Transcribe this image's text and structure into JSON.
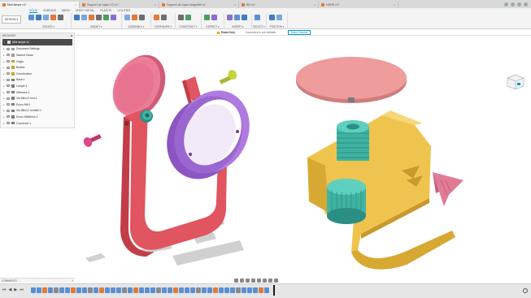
{
  "tabs": [
    {
      "label": "Mini lampe v1*",
      "active": true
    },
    {
      "label": "Support de tuyau V2 v1*",
      "active": false
    },
    {
      "label": "Support de tuyau Magnétik v1",
      "active": false
    },
    {
      "label": "BB v1*",
      "active": false
    },
    {
      "label": "HDRE v1*",
      "active": false
    }
  ],
  "ribbon": {
    "workspace": "DESIGN ▾",
    "workspace_tabs": [
      "SOLID",
      "SURFACE",
      "MESH",
      "SHEET METAL",
      "PLASTIC",
      "UTILITIES"
    ],
    "active_workspace_tab": "SOLID",
    "groups": [
      {
        "label": "CREATE ▾",
        "icons": [
          "sketch-icon",
          "extrude-icon",
          "revolve-icon",
          "hole-icon",
          "box-icon"
        ]
      },
      {
        "label": "MODIFY ▾",
        "icons": [
          "press-pull-icon",
          "fillet-icon",
          "chamfer-icon",
          "shell-icon",
          "combine-icon",
          "move-icon"
        ]
      },
      {
        "label": "ASSEMBLE ▾",
        "icons": [
          "new-component-icon",
          "joint-icon",
          "as-built-joint-icon"
        ]
      },
      {
        "label": "CONFIGURE ▾",
        "icons": [
          "configure-icon",
          "table-icon"
        ]
      },
      {
        "label": "CONSTRUCT ▾",
        "icons": [
          "offset-plane-icon",
          "axis-icon"
        ]
      },
      {
        "label": "INSPECT ▾",
        "icons": [
          "measure-icon",
          "interference-icon"
        ]
      },
      {
        "label": "INSERT ▾",
        "icons": [
          "insert-mesh-icon",
          "decal-icon",
          "canvas-icon"
        ]
      },
      {
        "label": "SELECT ▾",
        "icons": [
          "select-icon"
        ]
      },
      {
        "label": "POSITION ▾",
        "icons": [
          "capture-position-icon",
          "revert-icon"
        ]
      }
    ]
  },
  "status": {
    "read_only": "Read-Only",
    "message": "Document is not editable",
    "button": "Make Editable"
  },
  "browser": {
    "title": "BROWSER",
    "root": "Mini lampe v1",
    "items": [
      {
        "label": "Document Settings",
        "color": "#9e9e9e"
      },
      {
        "label": "Named Views",
        "color": "#9e9e9e"
      },
      {
        "label": "Origin",
        "color": "#c9a227"
      },
      {
        "label": "Bodies",
        "color": "#c9a227"
      },
      {
        "label": "Construction",
        "color": "#c9a227"
      },
      {
        "label": "Base:1",
        "color": "#7a7a7a"
      },
      {
        "label": "Lampe:1",
        "color": "#7a7a7a"
      },
      {
        "label": "Diffuseur:1",
        "color": "#7a7a7a"
      },
      {
        "label": "Vis M6x12 rom:1",
        "color": "#7a7a7a"
      },
      {
        "label": "Ecrou M6:1",
        "color": "#7a7a7a"
      },
      {
        "label": "Vis M6x12 rondelé:1",
        "color": "#7a7a7a"
      },
      {
        "label": "Ecrou M6Mince:1",
        "color": "#7a7a7a"
      },
      {
        "label": "Couvercle:1",
        "color": "#7a7a7a"
      }
    ]
  },
  "comments": {
    "label": "COMMENTS",
    "add": "+"
  },
  "timeline": {
    "controls": [
      "⏮",
      "◀",
      "▶",
      "⏭"
    ],
    "items": [
      "#5a8fd6",
      "#5a8fd6",
      "#e07b39",
      "#5a8fd6",
      "#8a8a8a",
      "#5a8fd6",
      "#5a8fd6",
      "#e07b39",
      "#5a8fd6",
      "#5a8fd6",
      "#8a8a8a",
      "#5a8fd6",
      "#e07b39",
      "#5a8fd6",
      "#5a8fd6",
      "#5a8fd6",
      "#8a8a8a",
      "#5a8fd6",
      "#e07b39",
      "#5a8fd6",
      "#5a8fd6",
      "#5a8fd6",
      "#8a8a8a",
      "#5a8fd6",
      "#5a8fd6",
      "#e07b39",
      "#5a8fd6",
      "#5a8fd6",
      "#5a8fd6",
      "#8a8a8a",
      "#5a8fd6",
      "#5a8fd6",
      "#e07b39",
      "#5a8fd6",
      "#5a8fd6",
      "#5a8fd6",
      "#8a8a8a",
      "#5a8fd6",
      "#5a8fd6",
      "#5a8fd6",
      "#e07b39",
      "#5a8fd6"
    ]
  },
  "colors": {
    "accent": "#0696d7",
    "red_part": "#e0555f",
    "pink_disc": "#e77b96",
    "purple_ring": "#b07ae0",
    "yellow_part": "#efc44e",
    "teal_part": "#3fb3a2",
    "olive_screw": "#c3d43a"
  }
}
